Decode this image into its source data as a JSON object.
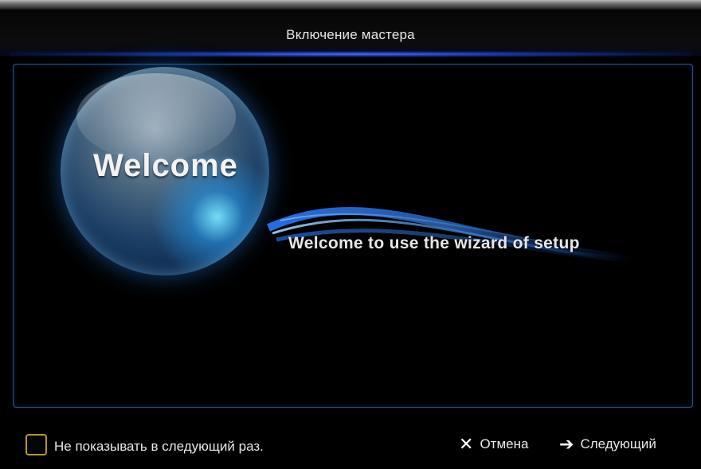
{
  "window": {
    "title": "Включение мастера"
  },
  "content": {
    "orb_label": "Welcome",
    "message": "Welcome to use the wizard of setup"
  },
  "footer": {
    "checkbox_label": "Не показывать в следующий раз.",
    "checkbox_checked": false,
    "cancel_label": "Отмена",
    "next_label": "Следующий",
    "cancel_icon": "close-icon",
    "next_icon": "arrow-right-icon"
  },
  "colors": {
    "accent": "#1f5a98",
    "title_glow": "#3c6cff",
    "checkbox_border": "#b59a1e",
    "orb": "#1c3f66",
    "text": "#e8e8e8"
  }
}
